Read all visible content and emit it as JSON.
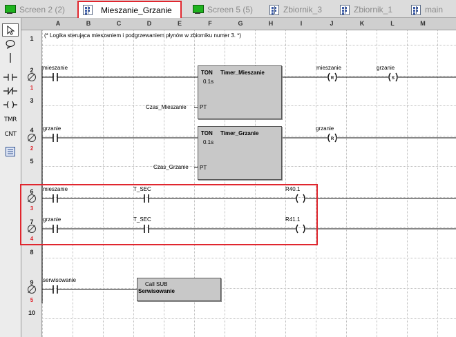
{
  "tabs": [
    {
      "label": "Screen 2 (2)",
      "icon": "screen-icon",
      "active": false
    },
    {
      "label": "Mieszanie_Grzanie",
      "icon": "program-icon",
      "active": true
    },
    {
      "label": "Screen 5 (5)",
      "icon": "screen-icon",
      "active": false
    },
    {
      "label": "Zbiornik_3",
      "icon": "program-icon",
      "active": false
    },
    {
      "label": "Zbiornik_1",
      "icon": "program-icon",
      "active": false
    },
    {
      "label": "main",
      "icon": "program-icon",
      "active": false
    }
  ],
  "palette": {
    "tools": [
      {
        "name": "pointer-tool",
        "label": ""
      },
      {
        "name": "comment-tool",
        "label": ""
      },
      {
        "name": "wire-tool",
        "label": ""
      },
      {
        "name": "contact-no-tool",
        "label": ""
      },
      {
        "name": "contact-nc-tool",
        "label": ""
      },
      {
        "name": "coil-tool",
        "label": ""
      },
      {
        "name": "timer-tool",
        "label": "TMR"
      },
      {
        "name": "counter-tool",
        "label": "CNT"
      },
      {
        "name": "function-block-tool",
        "label": ""
      }
    ]
  },
  "columns": [
    "A",
    "B",
    "C",
    "D",
    "E",
    "F",
    "G",
    "H",
    "I",
    "J",
    "K",
    "L",
    "M"
  ],
  "rows": [
    "1",
    "2",
    "3",
    "4",
    "5",
    "6",
    "7",
    "8",
    "9",
    "10"
  ],
  "comment": "(* Logika sterująca mieszaniem i podgrzewaniem płynów w zbiorniku numer 3. *)",
  "networks": [
    {
      "number": "1",
      "contact": "mieszanie",
      "block": {
        "type": "TON",
        "name": "Timer_Mieszanie",
        "preset": "0.1s",
        "pt_label": "PT",
        "pt_input": "Czas_Mieszanie"
      },
      "outputs": [
        {
          "name": "mieszanie",
          "kind": "(R)"
        },
        {
          "name": "grzanie",
          "kind": "(S)"
        }
      ]
    },
    {
      "number": "2",
      "contact": "grzanie",
      "block": {
        "type": "TON",
        "name": "Timer_Grzanie",
        "preset": "0.1s",
        "pt_label": "PT",
        "pt_input": "Czas_Grzanie"
      },
      "outputs": [
        {
          "name": "grzanie",
          "kind": "(R)"
        }
      ]
    },
    {
      "number": "3",
      "contacts": [
        "mieszanie",
        "T_SEC"
      ],
      "coil": "R40.1"
    },
    {
      "number": "4",
      "contacts": [
        "grzanie",
        "T_SEC"
      ],
      "coil": "R41.1"
    },
    {
      "number": "5",
      "contact": "serwisowanie",
      "call": {
        "line1": "Call SUB",
        "line2": "Serwisowanie"
      }
    }
  ],
  "colors": {
    "highlight": "#e0262e",
    "screen_icon": "#1fb31f",
    "block_fill": "#c8c8c8"
  }
}
